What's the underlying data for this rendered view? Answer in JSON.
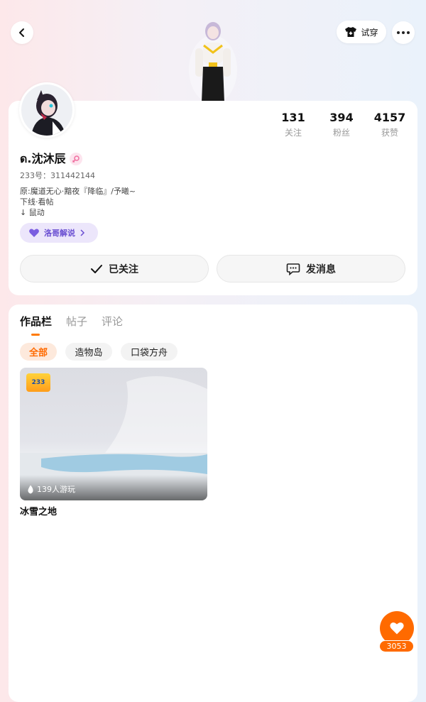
{
  "header": {
    "tryon_label": "试穿"
  },
  "profile": {
    "name": "ด.沈沐辰",
    "uid": "233号：311442144",
    "bio": "原:魔道无心·黯夜『降临』/予曦~\n下线·看帖\n↓ 鼠动",
    "stats": [
      {
        "value": "131",
        "label": "关注"
      },
      {
        "value": "394",
        "label": "粉丝"
      },
      {
        "value": "4157",
        "label": "获赞"
      }
    ],
    "tag_label": "洛哥解说",
    "follow_label": "已关注",
    "message_label": "发消息"
  },
  "tabs": [
    "作品栏",
    "帖子",
    "评论"
  ],
  "chips": [
    "全部",
    "造物岛",
    "口袋方舟"
  ],
  "works": [
    {
      "title": "冰雪之地",
      "plays": "139人游玩",
      "badge": "233"
    }
  ],
  "like": {
    "count": "3053"
  },
  "colors": {
    "accent": "#ff6a00",
    "tag_purple": "#6a4fd2"
  }
}
